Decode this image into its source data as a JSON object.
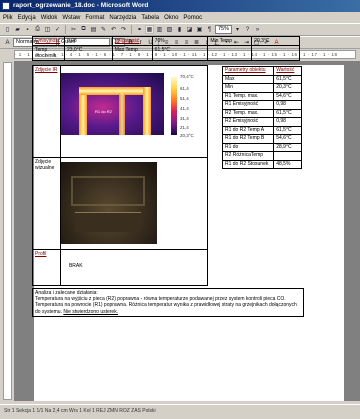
{
  "window": {
    "title": "raport_ogrzewanie_18.doc - Microsoft Word"
  },
  "menu": [
    "Plik",
    "Edycja",
    "Widok",
    "Wstaw",
    "Format",
    "Narzędzia",
    "Tabela",
    "Okno",
    "Pomoc"
  ],
  "toolbar": {
    "zoom": "75%",
    "style": "Normalny",
    "font": "Gulim",
    "font_size": "12"
  },
  "ruler": "· 1 · 1 · 2 · 1 · 3 · 1 · 4 · 1 · 5 · 1 · 6 · 1 · 7 · 1 · 8 · 1 · 9 · 1 · 10 · 1 · 11 · 1 · 12 · 1 · 13 · 1 · 14 · 1 · 15 · 1 · 16 · 1 · 17 · 1 · 18",
  "header_table": {
    "emissivity_label": "Emisyjność",
    "emissivity_value": "0,98",
    "humidity_label": "Wilgotność",
    "humidity_value": "70%",
    "min_temp_label": "Min Temp",
    "min_temp_value": "20,3°C",
    "ambient_label": "Temp otoczenia",
    "ambient_value": "23,0°C",
    "max_temp_label": "Max Temp",
    "max_temp_value": "61,5°C"
  },
  "thermal_section": {
    "label": "Zdjęcie IR",
    "spot_label": "R1 do R2",
    "scale": [
      "70,4°C",
      "61,4",
      "51,4",
      "41,4",
      "31,4",
      "21,4",
      "20,3°C"
    ]
  },
  "visual_section": {
    "label": "Zdjęcie wizualne"
  },
  "profile_section": {
    "label": "Profil",
    "value": "BRAK"
  },
  "parameters": {
    "header_param": "Parametry obiektu",
    "header_value": "Wartość",
    "rows": [
      {
        "name": "Max",
        "value": "61,5°C"
      },
      {
        "name": "Min",
        "value": "20,3°C"
      },
      {
        "name": "R1 Temp. max.",
        "value": "54,6°C"
      },
      {
        "name": "R1 Emisyjność",
        "value": "0,98"
      },
      {
        "name": "R2 Temp. max.",
        "value": "61,5°C"
      },
      {
        "name": "R2 Emisyjność",
        "value": "0,98"
      },
      {
        "name": "R1 do R2 Temp A",
        "value": "61,5°C"
      },
      {
        "name": "R1 do R2 Temp B",
        "value": "54,6°C"
      },
      {
        "name": "R1 do",
        "value": "28,9°C"
      },
      {
        "name": "R2 RóżnicaTemp",
        "value": ""
      },
      {
        "name": "R1 do R2 Stosunek",
        "value": "48,5%"
      }
    ]
  },
  "analysis": {
    "heading": "Analiza i zalecane działania:",
    "text": "Temperatura na wyjściu z pieca (R2) poprawna - równa temperaturze podawanej przez system kontroli pieca CO. Temperatura na powrocie (R1) poprawna. Różnica temperatur wynika z prawidłowej straty na grzejnikach dołączonych do systemu.",
    "link": "Nie stwierdzono usterek."
  },
  "statusbar": "Str 1   Sekcja 1   1/1   Na 2,4 cm  Wrs 1  Kol 1   REJ  ZMN  ROZ  ZAS  Polski"
}
